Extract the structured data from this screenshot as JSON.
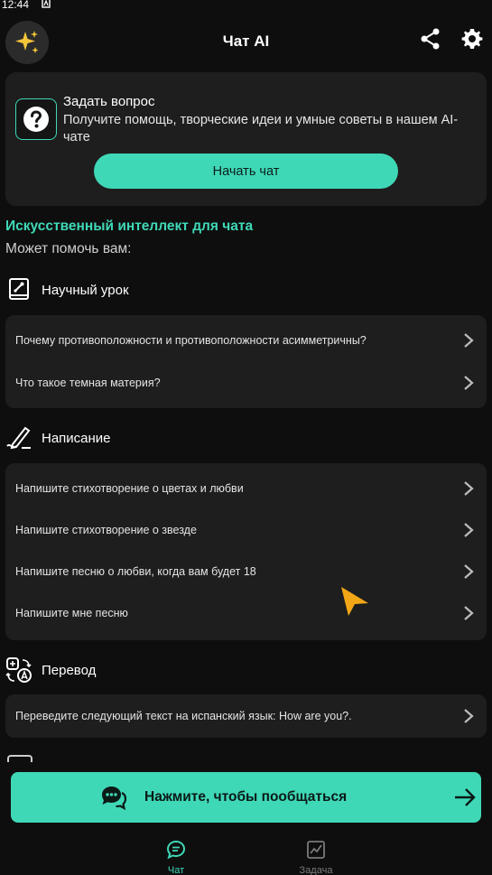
{
  "status_bar": {
    "time": "12:44"
  },
  "header": {
    "title": "Чат AI",
    "avatar_icon": "sparkle-icon",
    "share_icon": "share-icon",
    "settings_icon": "gear-icon"
  },
  "ask_card": {
    "title": "Задать вопрос",
    "description": "Получите помощь, творческие идеи и умные советы в нашем AI-чате",
    "button_label": "Начать чат"
  },
  "section": {
    "heading": "Искусственный интеллект для чата",
    "subheading": "Может помочь вам:"
  },
  "categories": [
    {
      "label": "Научный урок",
      "icon": "science-book-icon",
      "items": [
        "Почему противоположности и противоположности асимметричны?",
        "Что такое темная материя?"
      ]
    },
    {
      "label": "Написание",
      "icon": "pen-writing-icon",
      "items": [
        "Напишите стихотворение о цветах и любви",
        "Напишите стихотворение о звезде",
        "Напишите песню о любви, когда вам будет 18",
        "Напишите мне песню"
      ]
    },
    {
      "label": "Перевод",
      "icon": "translate-icon",
      "items": [
        "Переведите следующий текст на испанский язык: How are you?."
      ]
    }
  ],
  "cta": {
    "label": "Нажмите, чтобы пообщаться"
  },
  "bottom_nav": [
    {
      "label": "Чат",
      "icon": "chat-icon",
      "active": true
    },
    {
      "label": "Задача",
      "icon": "chart-icon",
      "active": false
    }
  ],
  "colors": {
    "accent": "#3fd8b7",
    "background": "#0e0e0e",
    "card": "#1e1e1e"
  }
}
